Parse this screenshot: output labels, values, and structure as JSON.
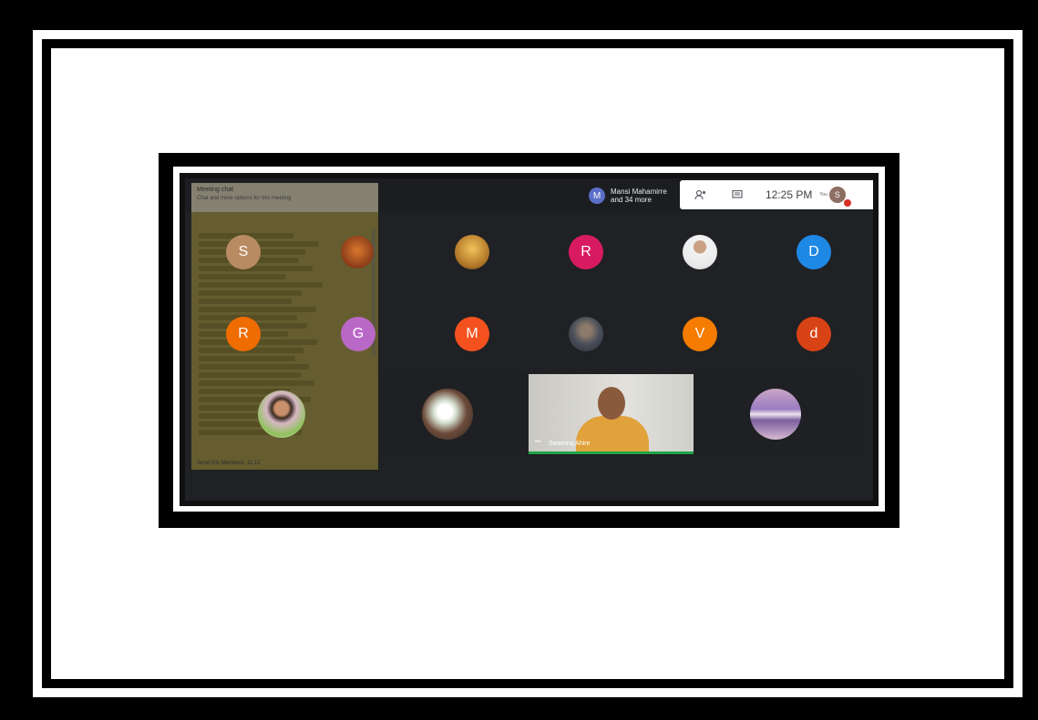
{
  "meeting": {
    "presenter_pill": {
      "initial": "M",
      "line1": "Mansi Mahamirre",
      "line2": "and 34 more"
    },
    "toolbar": {
      "people_icon": "people-icon",
      "chat_icon": "chat-icon",
      "time": "12:25 PM",
      "you_label": "You",
      "self_initial": "S"
    },
    "chat_panel": {
      "title": "Meeting chat",
      "subtitle": "Chat and more options for this meeting",
      "footer": "Send this Members: 11:12"
    },
    "participants": [
      {
        "initial": "S",
        "color": "#b98b63"
      },
      {
        "initial": "R",
        "color": "#d81b60"
      },
      {
        "initial": "D",
        "color": "#1e88e5"
      },
      {
        "initial": "R",
        "color": "#ef6c00"
      },
      {
        "initial": "G",
        "color": "#ba68c8"
      },
      {
        "initial": "M",
        "color": "#f4511e"
      },
      {
        "initial": "V",
        "color": "#f57c00"
      },
      {
        "initial": "d",
        "color": "#d84315"
      }
    ],
    "active_video": {
      "name": "Swarnraj Ahire"
    }
  }
}
